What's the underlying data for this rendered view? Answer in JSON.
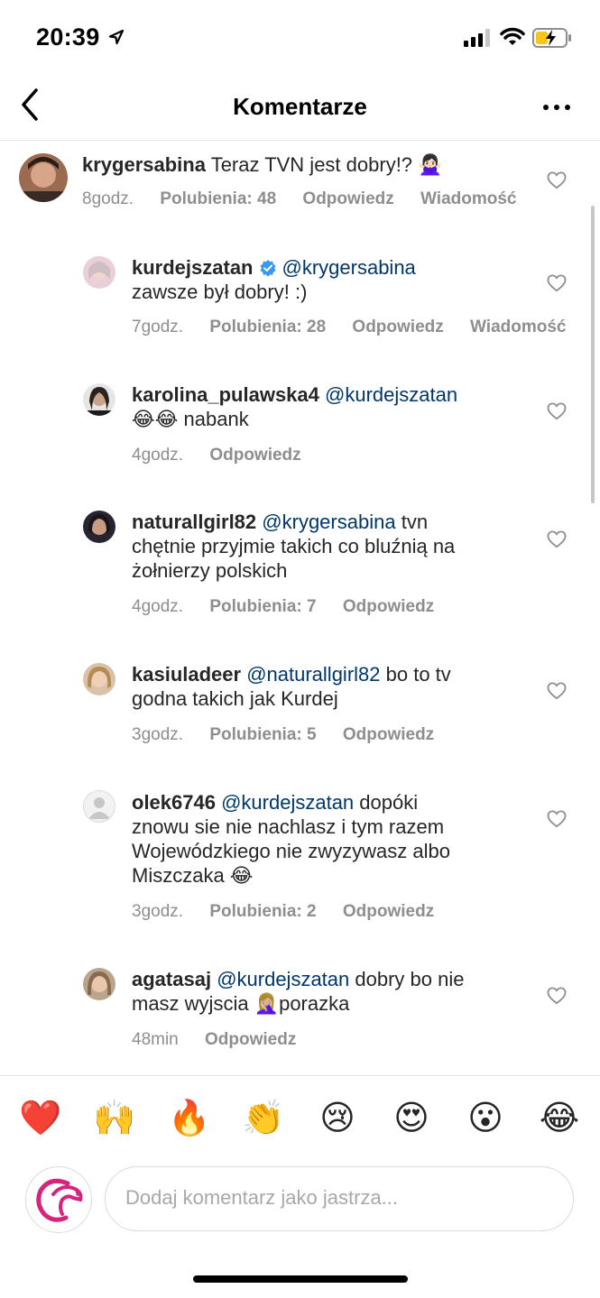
{
  "status_bar": {
    "time": "20:39"
  },
  "header": {
    "title": "Komentarze"
  },
  "comments": [
    {
      "user": "krygersabina",
      "mention": "",
      "text": "Teraz TVN jest dobry!? 🙅🏻‍♀️",
      "time": "8godz.",
      "likes": "Polubienia: 48",
      "reply": "Odpowiedz",
      "message": "Wiadomość"
    },
    {
      "user": "kurdejszatan",
      "mention": "@krygersabina",
      "text": "zawsze był dobry! :)",
      "time": "7godz.",
      "likes": "Polubienia: 28",
      "reply": "Odpowiedz",
      "message": "Wiadomość"
    },
    {
      "user": "karolina_pulawska4",
      "mention": "@kurdejszatan",
      "text": "😂😂 nabank",
      "time": "4godz.",
      "reply": "Odpowiedz"
    },
    {
      "user": "naturallgirl82",
      "mention": "@krygersabina",
      "text_line1": "tvn",
      "text_line2": "chętnie przyjmie takich co bluźnią na",
      "text_line3": "żołnierzy polskich",
      "time": "4godz.",
      "likes": "Polubienia: 7",
      "reply": "Odpowiedz"
    },
    {
      "user": "kasiuladeer",
      "mention": "@naturallgirl82",
      "text_line1": "bo to tv",
      "text_line2": "godna takich jak Kurdej",
      "time": "3godz.",
      "likes": "Polubienia: 5",
      "reply": "Odpowiedz"
    },
    {
      "user": "olek6746",
      "mention": "@kurdejszatan",
      "text_line1": "dopóki",
      "text_line2": "znowu sie nie nachlasz i tym razem",
      "text_line3": "Wojewódzkiego nie zwyzywasz albo",
      "text_line4": "Miszczaka 😂",
      "time": "3godz.",
      "likes": "Polubienia: 2",
      "reply": "Odpowiedz"
    },
    {
      "user": "agatasaj",
      "mention": "@kurdejszatan",
      "text_line1": "dobry bo nie",
      "text_line2": "masz wyjscia 🤦🏼‍♀️porazka",
      "time": "48min",
      "reply": "Odpowiedz"
    }
  ],
  "emoji_bar": [
    "❤️",
    "🙌",
    "🔥",
    "👏",
    "😢",
    "😍",
    "😮",
    "😂"
  ],
  "composer": {
    "placeholder": "Dodaj komentarz jako jastrza..."
  },
  "colors": {
    "mention": "#00376b",
    "meta": "#8e8e8e",
    "verified": "#3897f0"
  }
}
